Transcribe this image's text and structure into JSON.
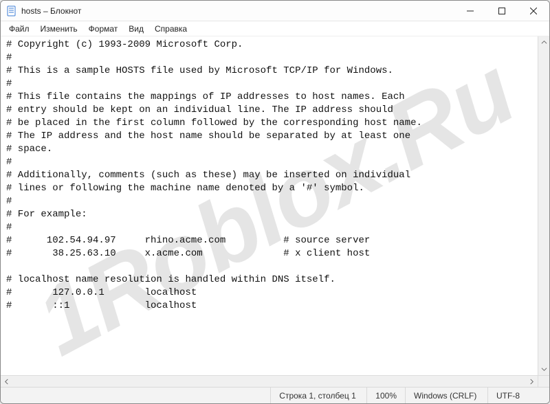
{
  "titlebar": {
    "title": "hosts – Блокнот"
  },
  "menu": {
    "file": "Файл",
    "edit": "Изменить",
    "format": "Формат",
    "view": "Вид",
    "help": "Справка"
  },
  "content": {
    "lines": [
      "# Copyright (c) 1993-2009 Microsoft Corp.",
      "#",
      "# This is a sample HOSTS file used by Microsoft TCP/IP for Windows.",
      "#",
      "# This file contains the mappings of IP addresses to host names. Each",
      "# entry should be kept on an individual line. The IP address should",
      "# be placed in the first column followed by the corresponding host name.",
      "# The IP address and the host name should be separated by at least one",
      "# space.",
      "#",
      "# Additionally, comments (such as these) may be inserted on individual",
      "# lines or following the machine name denoted by a '#' symbol.",
      "#",
      "# For example:",
      "#",
      "#      102.54.94.97     rhino.acme.com          # source server",
      "#       38.25.63.10     x.acme.com              # x client host",
      "",
      "# localhost name resolution is handled within DNS itself.",
      "#       127.0.0.1       localhost",
      "#       ::1             localhost"
    ]
  },
  "statusbar": {
    "position": "Строка 1, столбец 1",
    "zoom": "100%",
    "line_ending": "Windows (CRLF)",
    "encoding": "UTF-8"
  },
  "watermark": {
    "text": "1Roblox.Ru"
  }
}
